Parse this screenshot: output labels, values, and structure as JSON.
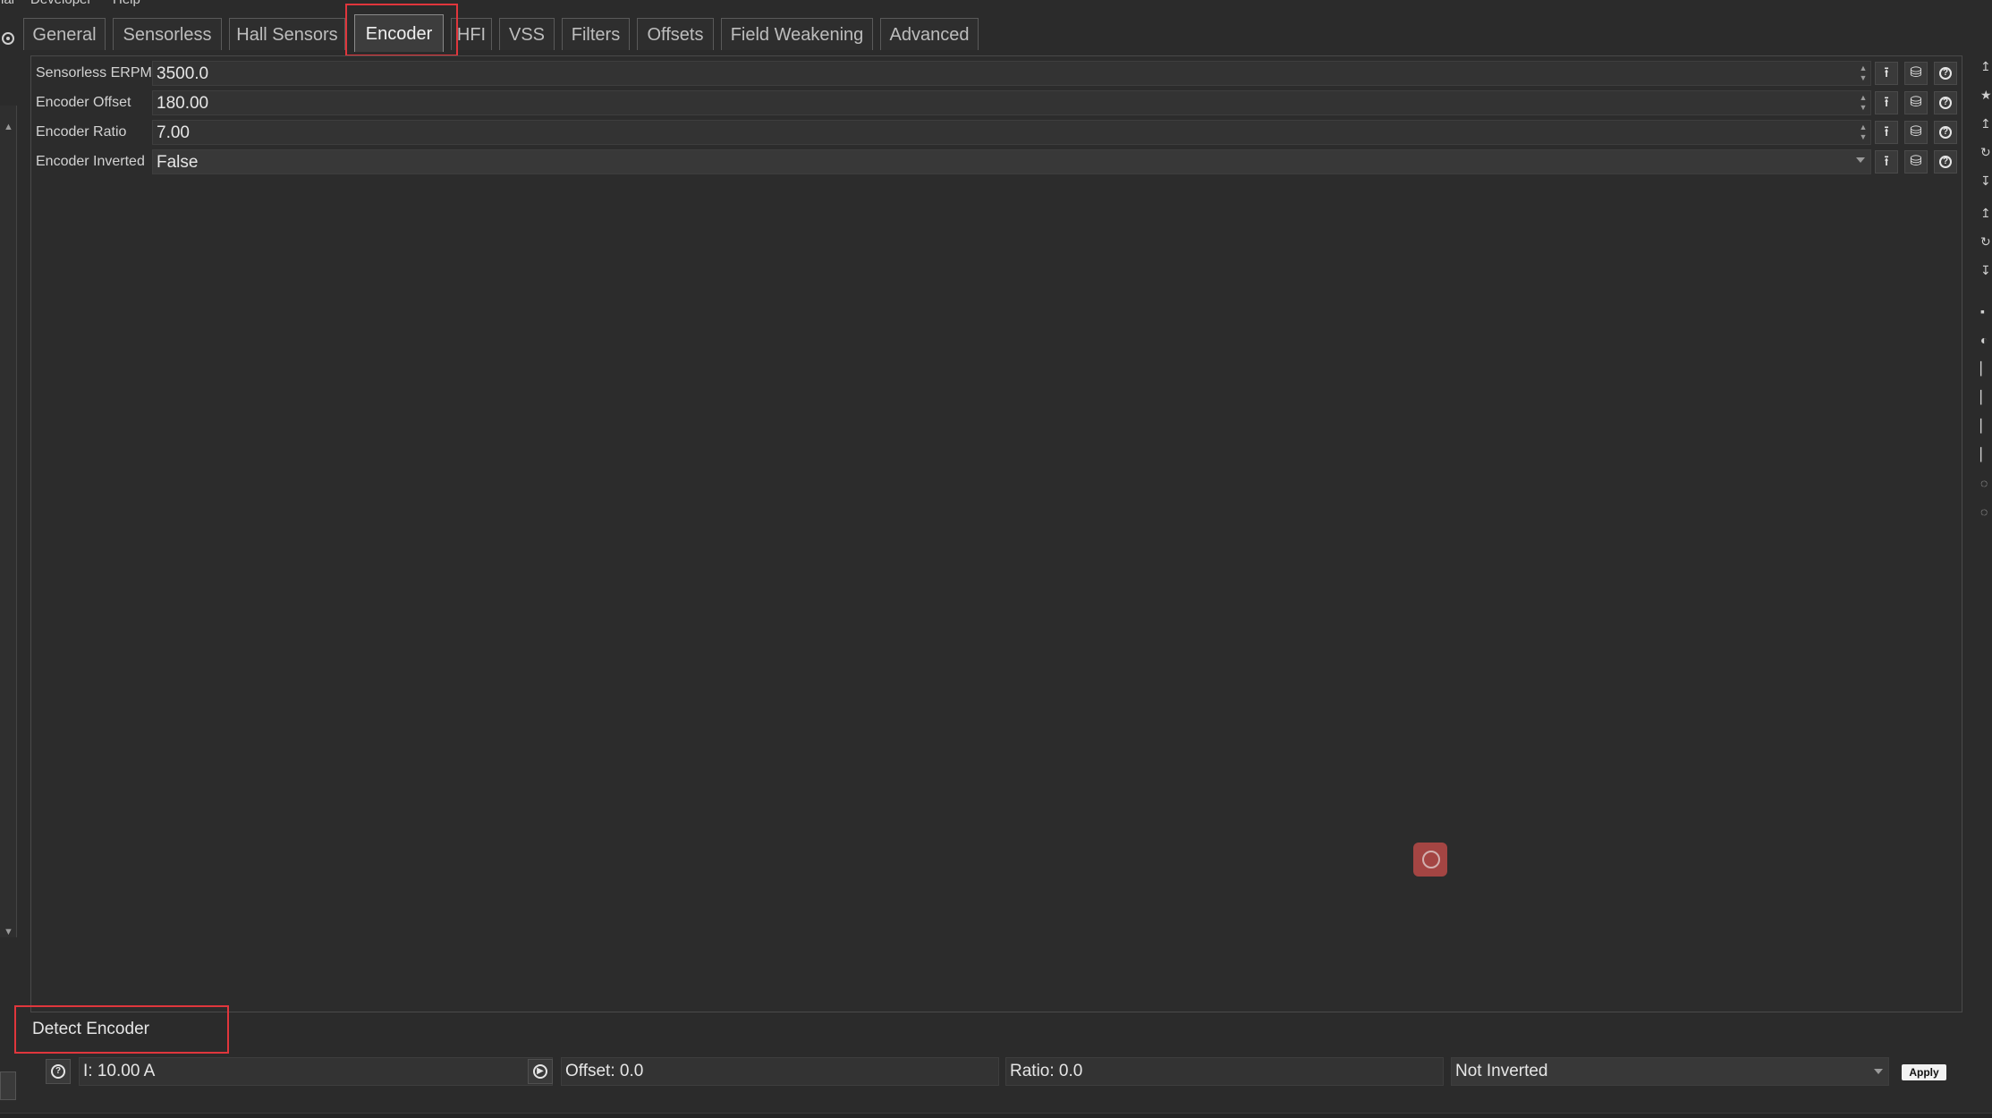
{
  "menu": [
    "nal",
    "Developer",
    "Help"
  ],
  "tabs": [
    {
      "label": "General",
      "active": false
    },
    {
      "label": "Sensorless",
      "active": false
    },
    {
      "label": "Hall Sensors",
      "active": false
    },
    {
      "label": "Encoder",
      "active": true
    },
    {
      "label": "HFI",
      "active": false
    },
    {
      "label": "VSS",
      "active": false
    },
    {
      "label": "Filters",
      "active": false
    },
    {
      "label": "Offsets",
      "active": false
    },
    {
      "label": "Field Weakening",
      "active": false
    },
    {
      "label": "Advanced",
      "active": false
    }
  ],
  "params": [
    {
      "label": "Sensorless ERPM",
      "value": "3500.0",
      "kind": "spin"
    },
    {
      "label": "Encoder Offset",
      "value": "180.00",
      "kind": "spin"
    },
    {
      "label": "Encoder Ratio",
      "value": "7.00",
      "kind": "spin"
    },
    {
      "label": "Encoder Inverted",
      "value": "False",
      "kind": "combo"
    }
  ],
  "detect": {
    "title": "Detect Encoder",
    "current": "I: 10.00 A",
    "offset": "Offset: 0.0",
    "ratio": "Ratio: 0.0",
    "inverted": "Not Inverted",
    "apply": "Apply"
  },
  "colors": {
    "highlight": "#e0363c",
    "background": "#2b2b2b"
  }
}
